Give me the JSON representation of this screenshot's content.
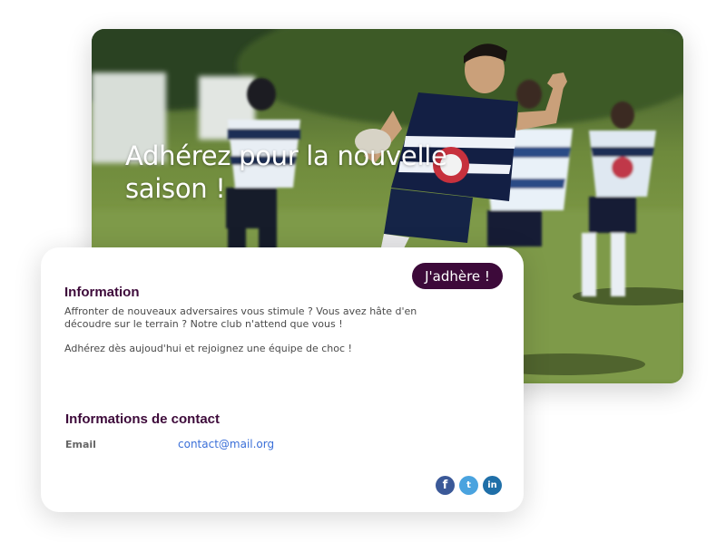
{
  "hero": {
    "title": "Adhérez pour la nouvelle saison !"
  },
  "card": {
    "join_button": "J'adhère !",
    "info_title": "Information",
    "info_paragraph_1": "Affronter de nouveaux adversaires vous stimule ? Vous avez hâte d'en découdre sur le terrain ? Notre club n'attend que vous !",
    "info_paragraph_2": "Adhérez dès aujoud'hui et rejoignez une équipe de choc !",
    "contact_title": "Informations de contact",
    "email_label": "Email",
    "email_value": "contact@mail.org"
  },
  "social": [
    {
      "name": "facebook-icon",
      "glyph": "f"
    },
    {
      "name": "twitter-icon",
      "glyph": "t"
    },
    {
      "name": "linkedin-icon",
      "glyph": "in"
    }
  ],
  "colors": {
    "brand": "#3d0a3a",
    "link": "#3a6fd8",
    "facebook": "#3b5998",
    "twitter": "#4aa3df",
    "linkedin": "#1f6fa8"
  }
}
